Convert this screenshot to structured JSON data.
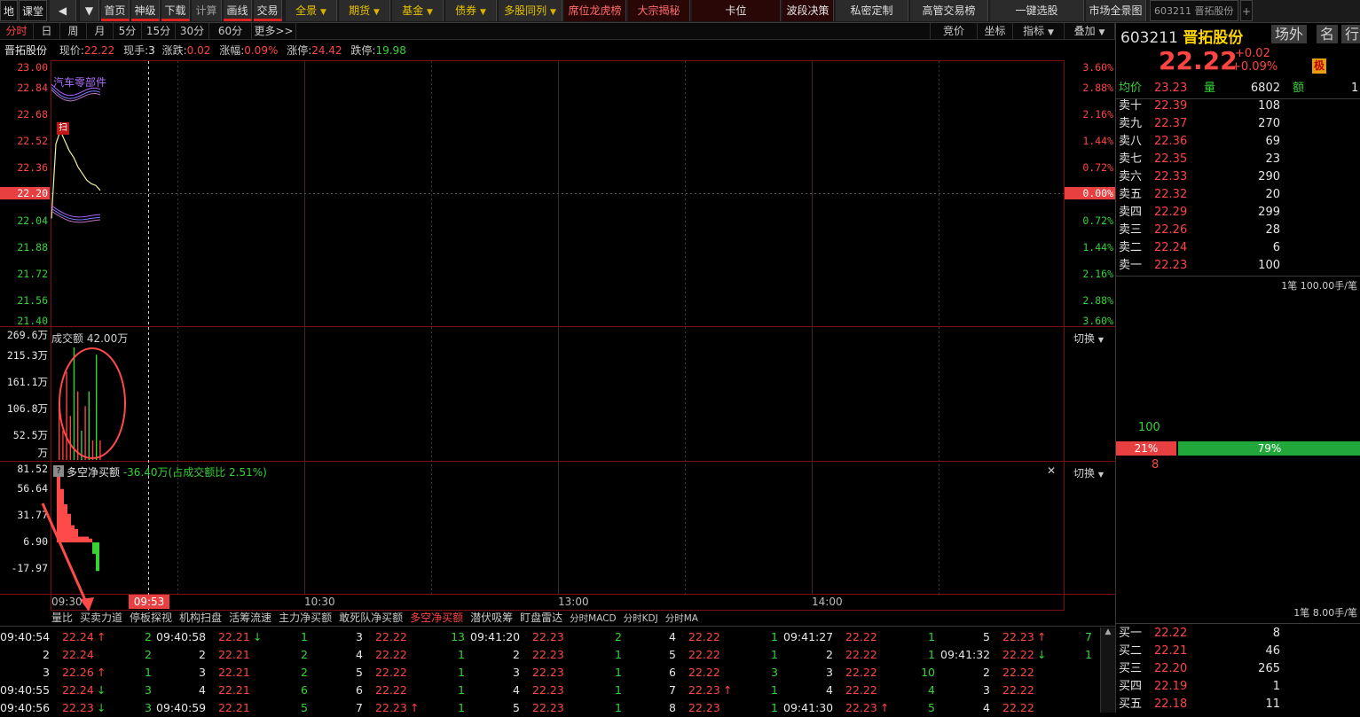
{
  "top_toolbar": {
    "left_buttons": [
      "地",
      "课堂",
      "首页",
      "神级",
      "下载",
      "计算",
      "画线",
      "交易"
    ],
    "nav_dropdowns": [
      "全景",
      "期货",
      "基金",
      "债券",
      "多股同列"
    ],
    "feature_buttons": [
      "席位龙虎榜",
      "大宗揭秘",
      "卡位",
      "波段决策",
      "私密定制",
      "高管交易榜",
      "一键选股",
      "市场全景图"
    ],
    "tab_label": "603211 晋拓股份",
    "add_tab": "+"
  },
  "period_tabs": [
    "分时",
    "日",
    "周",
    "月",
    "5分",
    "15分",
    "30分",
    "60分",
    "更多>>"
  ],
  "right_tools": [
    "竞价",
    "坐标",
    "指标",
    "叠加"
  ],
  "info": {
    "name": "晋拓股份",
    "price_label": "现价:",
    "price": "22.22",
    "hand_label": "现手:",
    "hand": "3",
    "change_label": "涨跌:",
    "change": "0.02",
    "pct_label": "涨幅:",
    "pct": "0.09%",
    "limit_up_label": "涨停:",
    "limit_up": "24.42",
    "limit_down_label": "跌停:",
    "limit_down": "19.98"
  },
  "price_chart": {
    "y_left": [
      "23.00",
      "22.84",
      "22.68",
      "22.52",
      "22.36",
      "22.20",
      "22.04",
      "21.88",
      "21.72",
      "21.56",
      "21.40"
    ],
    "y_right": [
      "3.60%",
      "2.88%",
      "2.16%",
      "1.44%",
      "0.72%",
      "0.00%",
      "0.72%",
      "1.44%",
      "2.16%",
      "2.88%",
      "3.60%"
    ],
    "overlay_label": "汽车零部件",
    "marker": "扫"
  },
  "volume_chart": {
    "title": "成交额",
    "value": "42.00万",
    "y_labels": [
      "269.6万",
      "215.3万",
      "161.1万",
      "106.8万",
      "52.5万",
      "万"
    ],
    "switch": "切换"
  },
  "net_chart": {
    "help": "?",
    "title": "多空净买额",
    "value": "-36.40万(占成交额比 2.51%)",
    "y_labels": [
      "81.52",
      "56.64",
      "31.77",
      "6.90",
      "-17.97"
    ],
    "switch": "切换",
    "close": "✕"
  },
  "time_axis": {
    "labels": [
      "09:30",
      "10:30",
      "13:00",
      "14:00"
    ],
    "cursor": "09:53"
  },
  "bottom_tabs": [
    "量比",
    "买卖力道",
    "停板探视",
    "机构扫盘",
    "活筹流速",
    "主力净买额",
    "敢死队净买额",
    "多空净买额",
    "潜伏吸筹",
    "盯盘雷达",
    "分时MACD",
    "分时KDJ",
    "分时MA"
  ],
  "bottom_active": "多空净买额",
  "trades": [
    [
      [
        "09:40:54",
        "22.24",
        "↑",
        "2"
      ],
      [
        "09:40:58",
        "22.21",
        "↓",
        "1"
      ],
      [
        "3",
        "22.22",
        "",
        "13"
      ],
      [
        "09:41:20",
        "22.23",
        "",
        "2"
      ],
      [
        "4",
        "22.22",
        "",
        "1"
      ],
      [
        "09:41:27",
        "22.22",
        "",
        "1"
      ],
      [
        "5",
        "22.23",
        "↑",
        "7"
      ]
    ],
    [
      [
        "2",
        "22.24",
        "",
        "2"
      ],
      [
        "2",
        "22.21",
        "",
        "2"
      ],
      [
        "4",
        "22.22",
        "",
        "1"
      ],
      [
        "2",
        "22.23",
        "",
        "1"
      ],
      [
        "5",
        "22.22",
        "",
        "1"
      ],
      [
        "2",
        "22.22",
        "",
        "1"
      ],
      [
        "09:41:32",
        "22.22",
        "↓",
        "1"
      ]
    ],
    [
      [
        "3",
        "22.26",
        "↑",
        "1"
      ],
      [
        "3",
        "22.21",
        "",
        "2"
      ],
      [
        "5",
        "22.22",
        "",
        "1"
      ],
      [
        "3",
        "22.23",
        "",
        "1"
      ],
      [
        "6",
        "22.22",
        "",
        "3"
      ],
      [
        "3",
        "22.22",
        "",
        "10"
      ],
      [
        "2",
        "22.22",
        "",
        ""
      ]
    ],
    [
      [
        "09:40:55",
        "22.24",
        "↓",
        "3"
      ],
      [
        "4",
        "22.21",
        "",
        "6"
      ],
      [
        "6",
        "22.22",
        "",
        "1"
      ],
      [
        "4",
        "22.23",
        "",
        "1"
      ],
      [
        "7",
        "22.23",
        "↑",
        "1"
      ],
      [
        "4",
        "22.22",
        "",
        "4"
      ],
      [
        "3",
        "22.22",
        "",
        ""
      ]
    ],
    [
      [
        "09:40:56",
        "22.23",
        "↓",
        "3"
      ],
      [
        "09:40:59",
        "22.21",
        "",
        "5"
      ],
      [
        "7",
        "22.23",
        "↑",
        "1"
      ],
      [
        "5",
        "22.23",
        "",
        "1"
      ],
      [
        "8",
        "22.23",
        "",
        "1"
      ],
      [
        "09:41:30",
        "22.23",
        "↑",
        "5"
      ],
      [
        "4",
        "22.22",
        "",
        ""
      ]
    ]
  ],
  "right_panel": {
    "code": "603211",
    "name": "晋拓股份",
    "tabs": [
      "场外",
      "名",
      "行"
    ],
    "price": "22.22",
    "change": "+0.02",
    "pct": "+0.09%",
    "badge": "极",
    "avg_label": "均价",
    "avg": "23.23",
    "vol_label": "量",
    "vol": "6802",
    "amt_label": "额",
    "amt": "1",
    "asks": [
      [
        "卖十",
        "22.39",
        "108"
      ],
      [
        "卖九",
        "22.37",
        "270"
      ],
      [
        "卖八",
        "22.36",
        "69"
      ],
      [
        "卖七",
        "22.35",
        "23"
      ],
      [
        "卖六",
        "22.33",
        "290"
      ],
      [
        "卖五",
        "22.32",
        "20"
      ],
      [
        "卖四",
        "22.29",
        "299"
      ],
      [
        "卖三",
        "22.26",
        "28"
      ],
      [
        "卖二",
        "22.24",
        "6"
      ],
      [
        "卖一",
        "22.23",
        "100"
      ]
    ],
    "ask_note": "1笔 100.00手/笔",
    "ratio_top": "100",
    "ratio_left": "21%",
    "ratio_right": "79%",
    "ratio_bottom": "8",
    "bid_note": "1笔 8.00手/笔",
    "bids": [
      [
        "买一",
        "22.22",
        "8"
      ],
      [
        "买二",
        "22.21",
        "46"
      ],
      [
        "买三",
        "22.20",
        "265"
      ],
      [
        "买四",
        "22.19",
        "1"
      ],
      [
        "买五",
        "22.18",
        "11"
      ]
    ]
  },
  "chart_data": [
    {
      "type": "line",
      "title": "",
      "x": [
        "09:30",
        "09:31",
        "09:32",
        "09:33",
        "09:34",
        "09:35",
        "09:36",
        "09:37",
        "09:38",
        "09:39",
        "09:40",
        "09:41"
      ],
      "ylim": [
        21.4,
        23.0
      ],
      "series": [
        {
          "name": "",
          "values": [
            22.05,
            22.5,
            22.58,
            22.52,
            22.46,
            22.42,
            22.36,
            22.32,
            22.28,
            22.26,
            22.25,
            22.22
          ]
        }
      ]
    },
    {
      "type": "bar",
      "title": "成交额",
      "x": [
        "09:30",
        "09:31",
        "09:32",
        "09:33",
        "09:34",
        "09:35",
        "09:36",
        "09:37",
        "09:38",
        "09:39",
        "09:40",
        "09:41"
      ],
      "ylim": [
        0,
        269.6
      ],
      "values": [
        120,
        60,
        180,
        90,
        230,
        140,
        60,
        110,
        140,
        40,
        215,
        40
      ]
    },
    {
      "type": "bar",
      "title": "多空净买额",
      "x": [
        "09:30",
        "09:31",
        "09:32",
        "09:33",
        "09:34",
        "09:35",
        "09:36",
        "09:37",
        "09:38",
        "09:39",
        "09:40",
        "09:41"
      ],
      "ylim": [
        -30,
        81.52
      ],
      "values": [
        70,
        56,
        40,
        30,
        18,
        14,
        6,
        6,
        6,
        4,
        -12,
        -30
      ]
    }
  ]
}
